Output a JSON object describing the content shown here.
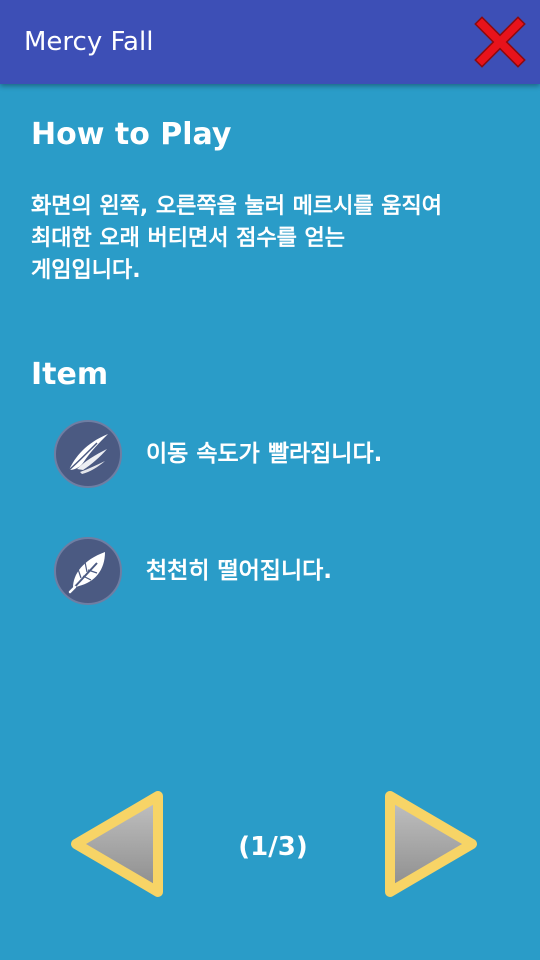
{
  "app_bar": {
    "title": "Mercy Fall",
    "close_icon": "close-x-icon",
    "close_icon_color": "#e8131b"
  },
  "how_to_play": {
    "heading": "How to Play",
    "description_lines": [
      "화면의 왼쪽, 오른쪽을 눌러 메르시를 움직여",
      "최대한 오래 버티면서 점수를 얻는",
      "게임입니다."
    ]
  },
  "items": {
    "heading": "Item",
    "list": [
      {
        "icon": "wing-icon",
        "text": "이동 속도가 빨라집니다."
      },
      {
        "icon": "feather-icon",
        "text": "천천히 떨어집니다."
      }
    ]
  },
  "pager": {
    "page_label": "(1/3)",
    "current_page": 1,
    "total_pages": 3,
    "prev_icon": "left-triangle-icon",
    "next_icon": "right-triangle-icon"
  },
  "colors": {
    "app_bar": "#3d4fb6",
    "background": "#2a9cc8",
    "item_icon_bg": "#4b5a82",
    "arrow_border": "#f7d466",
    "arrow_fill": "#a7a7a7"
  }
}
